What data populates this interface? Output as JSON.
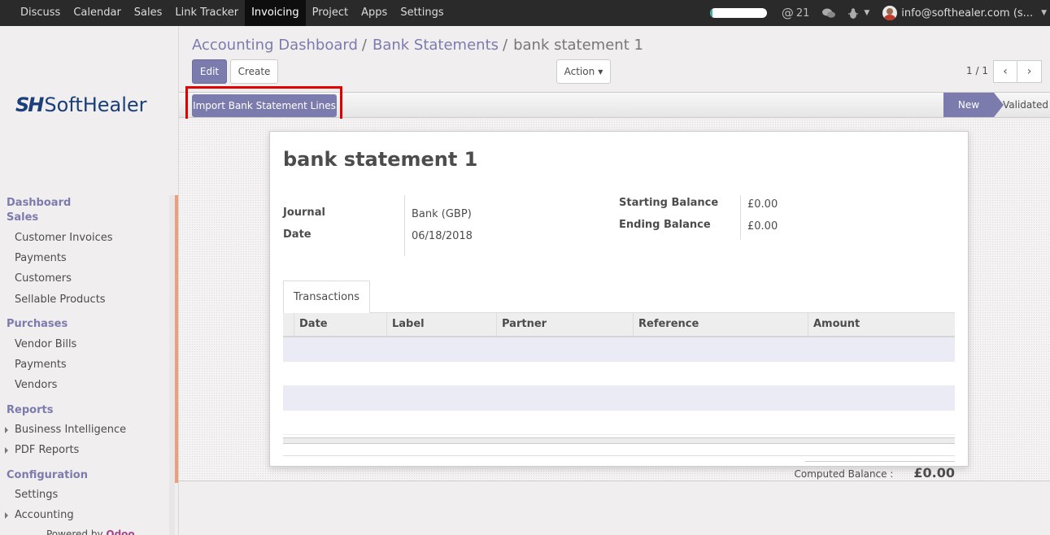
{
  "topbar": {
    "menu": [
      "Discuss",
      "Calendar",
      "Sales",
      "Link Tracker",
      "Invoicing",
      "Project",
      "Apps",
      "Settings"
    ],
    "active": "Invoicing",
    "progress_fraction": 0.05,
    "mentions_count": "21",
    "user": "info@softhealer.com (s..."
  },
  "sidebar": {
    "logo_mark": "SH",
    "logo_text": "SoftHealer",
    "dashboard": "Dashboard",
    "sales_head": "Sales",
    "sales_items": [
      "Customer Invoices",
      "Payments",
      "Customers",
      "Sellable Products"
    ],
    "purchases_head": "Purchases",
    "purchases_items": [
      "Vendor Bills",
      "Payments",
      "Vendors"
    ],
    "reports_head": "Reports",
    "reports_items": [
      "Business Intelligence",
      "PDF Reports"
    ],
    "config_head": "Configuration",
    "config_items": [
      "Settings",
      "Accounting"
    ],
    "powered_by": "Powered by",
    "powered_brand": "Odoo"
  },
  "breadcrumb": {
    "item1": "Accounting Dashboard",
    "item2": "Bank Statements",
    "current": "bank statement 1",
    "sep": "/"
  },
  "buttons": {
    "edit": "Edit",
    "create": "Create",
    "action": "Action",
    "import": "Import Bank Statement Lines"
  },
  "pager": {
    "text": "1 / 1"
  },
  "stages": {
    "new": "New",
    "validated": "Validated"
  },
  "record": {
    "title": "bank statement 1",
    "journal_label": "Journal",
    "journal_value": "Bank (GBP)",
    "date_label": "Date",
    "date_value": "06/18/2018",
    "start_label": "Starting Balance",
    "start_value": "£0.00",
    "end_label": "Ending Balance",
    "end_value": "£0.00"
  },
  "tabs": {
    "transactions": "Transactions"
  },
  "table": {
    "columns": [
      "Date",
      "Label",
      "Partner",
      "Reference",
      "Amount"
    ]
  },
  "footer": {
    "computed_label": "Computed Balance :",
    "computed_value": "£0.00"
  },
  "colors": {
    "primary": "#7c7bad",
    "highlight": "#e00000",
    "topbar": "#2a2a2a"
  }
}
